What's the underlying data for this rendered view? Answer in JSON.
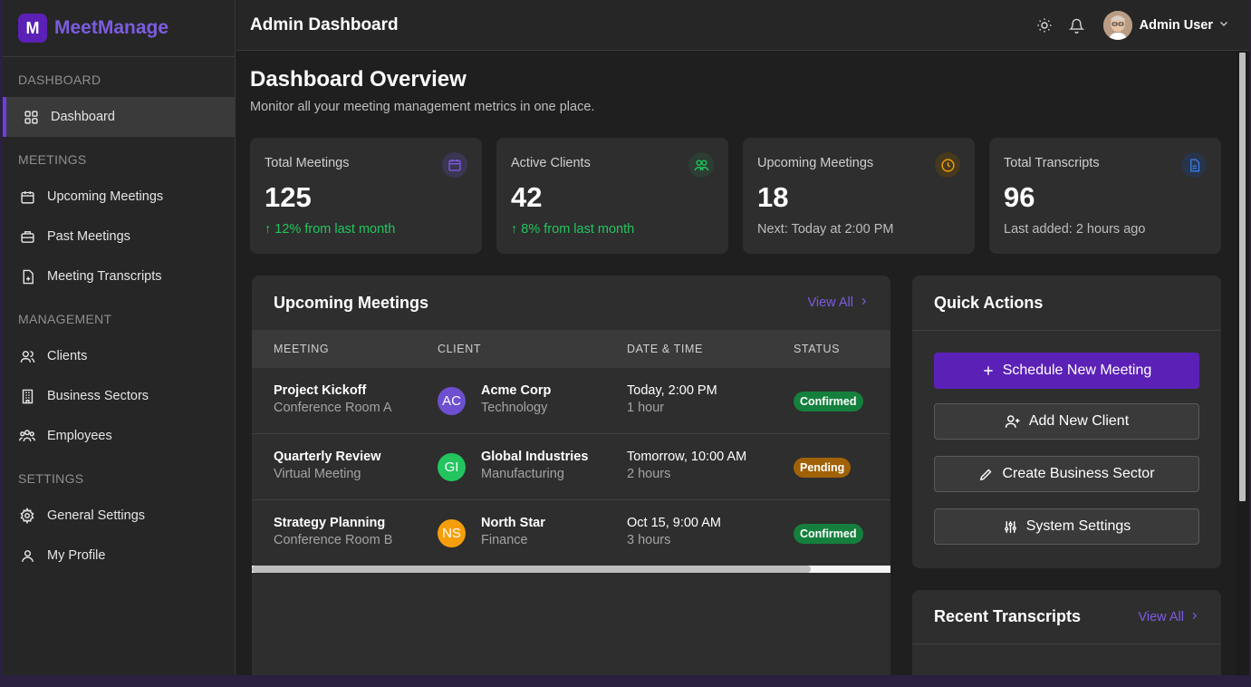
{
  "brand": {
    "logo_letter": "M",
    "name": "MeetManage",
    "accent": "#7c5ce0"
  },
  "sidebar": {
    "sections": [
      {
        "title": "DASHBOARD",
        "items": [
          {
            "label": "Dashboard",
            "icon": "grid-icon",
            "active": true
          }
        ]
      },
      {
        "title": "MEETINGS",
        "items": [
          {
            "label": "Upcoming Meetings",
            "icon": "calendar-icon"
          },
          {
            "label": "Past Meetings",
            "icon": "briefcase-icon"
          },
          {
            "label": "Meeting Transcripts",
            "icon": "file-plus-icon"
          }
        ]
      },
      {
        "title": "MANAGEMENT",
        "items": [
          {
            "label": "Clients",
            "icon": "users-icon"
          },
          {
            "label": "Business Sectors",
            "icon": "building-icon"
          },
          {
            "label": "Employees",
            "icon": "team-icon"
          }
        ]
      },
      {
        "title": "SETTINGS",
        "items": [
          {
            "label": "General Settings",
            "icon": "gear-icon"
          },
          {
            "label": "My Profile",
            "icon": "user-icon"
          }
        ]
      }
    ]
  },
  "topbar": {
    "title": "Admin Dashboard",
    "user_name": "Admin User"
  },
  "page": {
    "title": "Dashboard Overview",
    "subtitle": "Monitor all your meeting management metrics in one place."
  },
  "stats": [
    {
      "label": "Total Meetings",
      "value": "125",
      "foot": "12% from last month",
      "trend": "up",
      "icon": "calendar-icon",
      "icon_color": "#7c5ce0"
    },
    {
      "label": "Active Clients",
      "value": "42",
      "foot": "8% from last month",
      "trend": "up",
      "icon": "users-icon",
      "icon_color": "#22c55e"
    },
    {
      "label": "Upcoming Meetings",
      "value": "18",
      "foot": "Next: Today at 2:00 PM",
      "icon": "clock-icon",
      "icon_color": "#f59e0b"
    },
    {
      "label": "Total Transcripts",
      "value": "96",
      "foot": "Last added: 2 hours ago",
      "icon": "document-icon",
      "icon_color": "#3b82f6"
    }
  ],
  "upcoming": {
    "title": "Upcoming Meetings",
    "view_all": "View All",
    "columns": [
      "MEETING",
      "CLIENT",
      "DATE & TIME",
      "STATUS"
    ],
    "rows": [
      {
        "name": "Project Kickoff",
        "location": "Conference Room A",
        "initials": "AC",
        "avatar_color": "#6d4fd0",
        "client": "Acme Corp",
        "sector": "Technology",
        "date": "Today, 2:00 PM",
        "duration": "1 hour",
        "status": "Confirmed"
      },
      {
        "name": "Quarterly Review",
        "location": "Virtual Meeting",
        "initials": "GI",
        "avatar_color": "#22c55e",
        "client": "Global Industries",
        "sector": "Manufacturing",
        "date": "Tomorrow, 10:00 AM",
        "duration": "2 hours",
        "status": "Pending"
      },
      {
        "name": "Strategy Planning",
        "location": "Conference Room B",
        "initials": "NS",
        "avatar_color": "#f59e0b",
        "client": "North Star",
        "sector": "Finance",
        "date": "Oct 15, 9:00 AM",
        "duration": "3 hours",
        "status": "Confirmed"
      }
    ]
  },
  "quick_actions": {
    "title": "Quick Actions",
    "buttons": [
      {
        "label": "Schedule New Meeting",
        "icon": "plus-icon",
        "style": "primary"
      },
      {
        "label": "Add New Client",
        "icon": "user-plus-icon",
        "style": "secondary"
      },
      {
        "label": "Create Business Sector",
        "icon": "pencil-icon",
        "style": "secondary"
      },
      {
        "label": "System Settings",
        "icon": "sliders-icon",
        "style": "secondary"
      }
    ]
  },
  "recent_transcripts": {
    "title": "Recent Transcripts",
    "view_all": "View All"
  }
}
